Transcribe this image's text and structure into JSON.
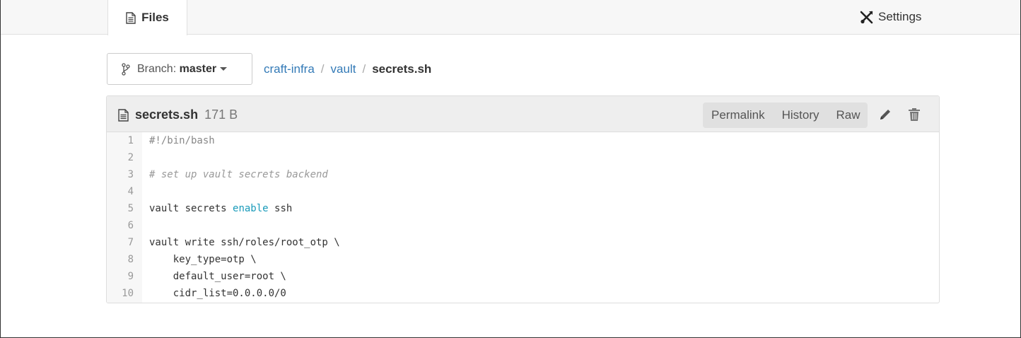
{
  "tabs": {
    "files_label": "Files",
    "settings_label": "Settings"
  },
  "branch": {
    "prefix": "Branch:",
    "name": "master"
  },
  "breadcrumb": {
    "repo": "craft-infra",
    "folder": "vault",
    "file": "secrets.sh",
    "separator": "/"
  },
  "file": {
    "name": "secrets.sh",
    "size": "171 B",
    "actions": {
      "permalink": "Permalink",
      "history": "History",
      "raw": "Raw"
    }
  },
  "code": {
    "lines": [
      {
        "n": "1",
        "parts": [
          {
            "t": "#!/bin/bash",
            "c": "shebang"
          }
        ]
      },
      {
        "n": "2",
        "parts": []
      },
      {
        "n": "3",
        "parts": [
          {
            "t": "# set up vault secrets backend",
            "c": "comment"
          }
        ]
      },
      {
        "n": "4",
        "parts": []
      },
      {
        "n": "5",
        "parts": [
          {
            "t": "vault secrets ",
            "c": ""
          },
          {
            "t": "enable",
            "c": "keyword"
          },
          {
            "t": " ssh",
            "c": ""
          }
        ]
      },
      {
        "n": "6",
        "parts": []
      },
      {
        "n": "7",
        "parts": [
          {
            "t": "vault write ssh/roles/root_otp \\",
            "c": ""
          }
        ]
      },
      {
        "n": "8",
        "parts": [
          {
            "t": "    key_type=otp \\",
            "c": ""
          }
        ]
      },
      {
        "n": "9",
        "parts": [
          {
            "t": "    default_user=root \\",
            "c": ""
          }
        ]
      },
      {
        "n": "10",
        "parts": [
          {
            "t": "    cidr_list=0.0.0.0/0",
            "c": ""
          }
        ]
      }
    ]
  },
  "icons": {
    "files_tab": "document-icon",
    "settings_tab": "tools-icon",
    "branch": "git-branch-icon",
    "file": "document-icon",
    "edit": "pencil-icon",
    "delete": "trash-icon"
  },
  "colors": {
    "link": "#337ab7",
    "keyword": "#1a9bba"
  }
}
